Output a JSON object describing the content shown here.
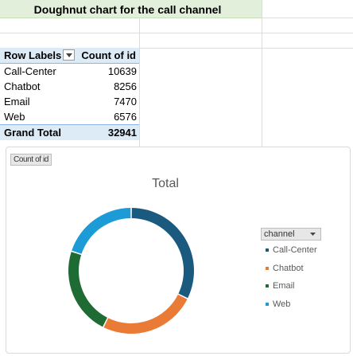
{
  "sheet": {
    "title": "Doughnut chart for the call channel"
  },
  "pivot": {
    "header_labels": "Row Labels",
    "header_values": "Count of id",
    "rows": [
      {
        "label": "Call-Center",
        "value": "10639"
      },
      {
        "label": "Chatbot",
        "value": "8256"
      },
      {
        "label": "Email",
        "value": "7470"
      },
      {
        "label": "Web",
        "value": "6576"
      }
    ],
    "total_label": "Grand Total",
    "total_value": "32941"
  },
  "chart": {
    "value_field_button": "Count of id",
    "legend_field_button": "channel"
  },
  "chart_data": {
    "type": "pie",
    "variant": "doughnut",
    "title": "Total",
    "categories": [
      "Call-Center",
      "Chatbot",
      "Email",
      "Web"
    ],
    "values": [
      10639,
      8256,
      7470,
      6576
    ],
    "colors": [
      "#1b5a7f",
      "#e97b36",
      "#1f6b34",
      "#1c9bd6"
    ],
    "legend_position": "right"
  }
}
